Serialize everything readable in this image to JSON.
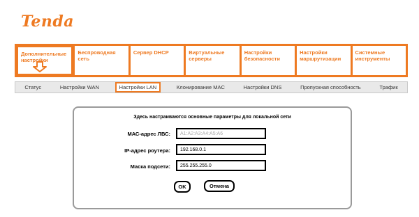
{
  "brand": "Tenda",
  "colors": {
    "accent": "#ee7a22",
    "panel_border": "#9a9a9a"
  },
  "top_tabs": [
    "Дополнительные настройки",
    "Беспроводная сеть",
    "Сервер DHCP",
    "Виртуальные серверы",
    "Настройки безопасности",
    "Настройки маршрутизации",
    "Системные инструменты"
  ],
  "sub_tabs": [
    "Статус",
    "Настройки WAN",
    "Настройки LAN",
    "Клонирование MAC",
    "Настройки DNS",
    "Пропускная способность",
    "Трафик"
  ],
  "active_sub_tab": "Настройки LAN",
  "panel": {
    "description": "Здесь настраиваются основные параметры для локальной сети",
    "mac_label": "МАС-адрес ЛВС:",
    "mac_value": "A1:A2:A3:A4:A5:A6",
    "ip_label": "IP-адрес роутера:",
    "ip_value": "192.168.0.1",
    "mask_label": "Маска подсети:",
    "mask_value": "255.255.255.0",
    "ok_label": "OK",
    "cancel_label": "Отмена"
  }
}
